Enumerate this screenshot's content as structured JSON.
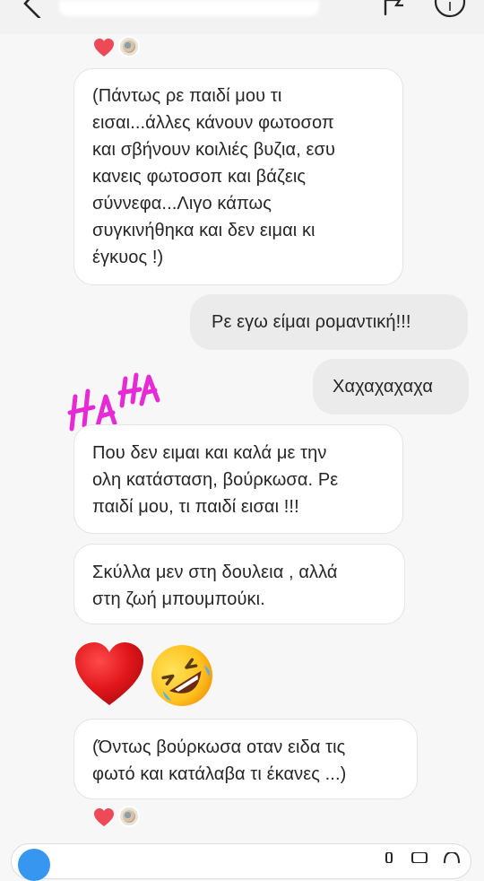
{
  "header": {
    "back_icon": "chevron-left-icon",
    "flag_icon": "flag-icon",
    "info_icon": "info-icon",
    "info_glyph": "i"
  },
  "messages": [
    {
      "id": "m1",
      "side": "in",
      "text": "(Πάντως ρε παιδί μου τι\nεισαι...άλλες κάνουν φωτοσοπ\nκαι σβήνουν κοιλιές βυζια, εσυ\nκανεις φωτοσοπ και βάζεις\nσύννεφα...Λιγο κάπως\nσυγκινήθηκα και δεν ειμαι κι\nέγκυος !)"
    },
    {
      "id": "m2",
      "side": "out",
      "text": "Ρε εγω είμαι ρομαντική!!!"
    },
    {
      "id": "m3",
      "side": "out",
      "text": "Χαχαχαχαχα"
    },
    {
      "id": "m4",
      "side": "in",
      "text": "Που δεν ειμαι και καλά με την\nολη κατάσταση, βούρκωσα. Ρε\nπαιδί μου, τι παιδί εισαι !!!"
    },
    {
      "id": "m5",
      "side": "in",
      "text": "Σκύλλα μεν στη δουλεια , αλλά\nστη ζωή μπουμπούκι."
    },
    {
      "id": "m6",
      "side": "in",
      "text": "(Όντως βούρκωσα οταν ειδα τις\nφωτό και κατάλαβα τι έκανες ...)"
    }
  ],
  "reactions": {
    "emoji": "heart-icon",
    "avatar": "avatar"
  },
  "sticker": {
    "name": "haha-sticker",
    "text": "HAHA",
    "color": "#e62ad6"
  },
  "emoji_message": [
    "red-heart-emoji",
    "rolling-on-floor-laughing-emoji"
  ],
  "colors": {
    "incoming_bubble": "#ffffff",
    "outgoing_bubble": "#ebebeb",
    "heart": "#ed4956",
    "text": "#262626",
    "camera": "#3797f0"
  },
  "composer": {
    "camera_icon": "camera-icon"
  }
}
